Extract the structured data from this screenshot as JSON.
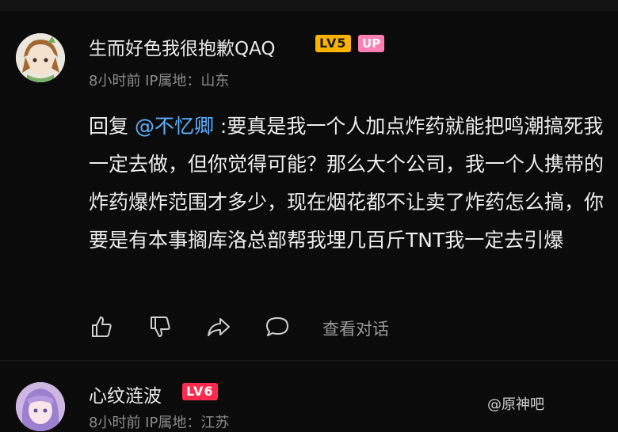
{
  "comment1": {
    "username": "生而好色我很抱歉QAQ",
    "level": "LV5",
    "up_badge": "UP",
    "meta": "8小时前 IP属地：山东",
    "reply_prefix": "回复 ",
    "mention": "@不忆卿",
    "text": " :要真是我一个人加点炸药就能把鸣潮搞死我一定去做，但你觉得可能？那么大个公司，我一个人携带的炸药爆炸范围才多少，现在烟花都不让卖了炸药怎么搞，你要是有本事搁库洛总部帮我埋几百斤TNT我一定去引爆",
    "actions": {
      "like_icon": "thumbs-up-icon",
      "dislike_icon": "thumbs-down-icon",
      "share_icon": "share-icon",
      "reply_icon": "comment-icon",
      "view_reply_label": "查看对话"
    }
  },
  "comment2": {
    "username": "心纹涟波",
    "level": "LV6",
    "meta": "8小时前 IP属地：江苏"
  },
  "watermark": "@原神吧",
  "colors": {
    "background": "#0b0b0b",
    "mention": "#5fb1ff",
    "lv5": "#ffb300",
    "lv6": "#ff2b4e",
    "up": "#ff7fb3"
  }
}
